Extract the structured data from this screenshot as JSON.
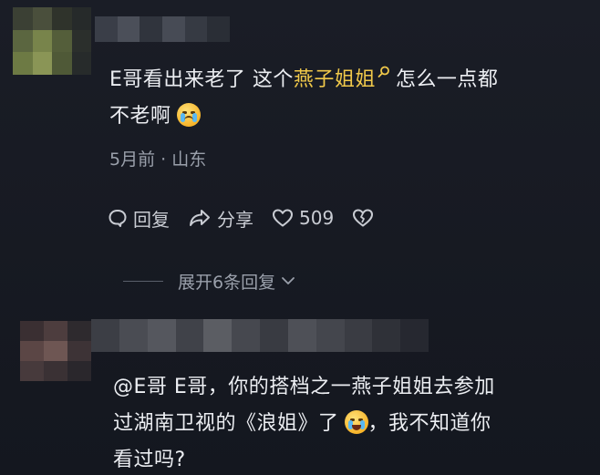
{
  "comment1": {
    "line1_prefix": "E哥看出来老了 这个",
    "highlight": "燕子姐姐",
    "line1_suffix": "怎么一点都",
    "line2": "不老啊",
    "emoji": "crying-face",
    "meta": "5月前 · 山东",
    "actions": {
      "reply": "回复",
      "share": "分享",
      "like_count": "509"
    },
    "expand_label": "展开6条回复"
  },
  "comment2": {
    "line1": "@E哥 E哥，你的搭档之一燕子姐姐去参加",
    "line2_prefix": "过湖南卫视的《浪姐》了",
    "line2_suffix": "，我不知道你",
    "emoji": "laughing-face",
    "line3": "看过吗?"
  },
  "colors": {
    "background": "#161922",
    "text": "#eceef2",
    "muted": "#9aa0ab",
    "highlight": "#f1c94a"
  }
}
